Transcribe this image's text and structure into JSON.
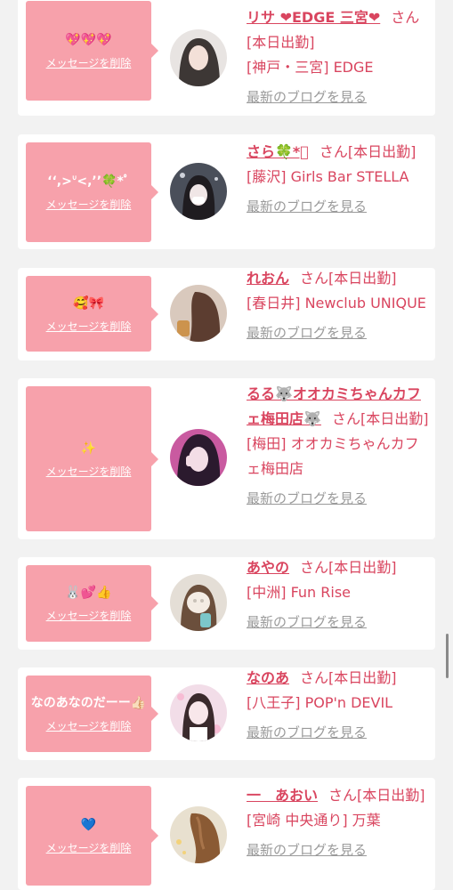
{
  "delete_label": "メッセージを削除",
  "blog_label": "最新のブログを見る",
  "san_label": "さん",
  "cards": [
    {
      "message": "💖💖💖",
      "name": "リサ ❤EDGE 三宮❤",
      "status": "[本日出勤]",
      "shop": "[神戸・三宮] EDGE"
    },
    {
      "message": "‘‘,>ᐡ<,’’🍀*ﾟ",
      "name": "さら🍀*ﾟ",
      "status": "[本日出勤]",
      "shop": "[藤沢] Girls Bar STELLA"
    },
    {
      "message": "🥰🎀",
      "name": "れおん",
      "status": "[本日出勤]",
      "shop": "[春日井] Newclub UNIQUE"
    },
    {
      "message": "✨",
      "name": "るる🐺オオカミちゃんカフェ梅田店🐺",
      "status": "[本日出勤]",
      "shop": "[梅田] オオカミちゃんカフェ梅田店"
    },
    {
      "message": "🐰💕👍",
      "name": "あやの",
      "status": "[本日出勤]",
      "shop": "[中洲] Fun Rise"
    },
    {
      "message": "なのあなのだーー👍🏻",
      "name": "なのあ",
      "status": "[本日出勤]",
      "shop": "[八王子] POP'n DEVIL"
    },
    {
      "message": "💙",
      "name": "一　あおい",
      "status": "[本日出勤]",
      "shop": "[宮崎 中央通り] 万葉"
    }
  ]
}
